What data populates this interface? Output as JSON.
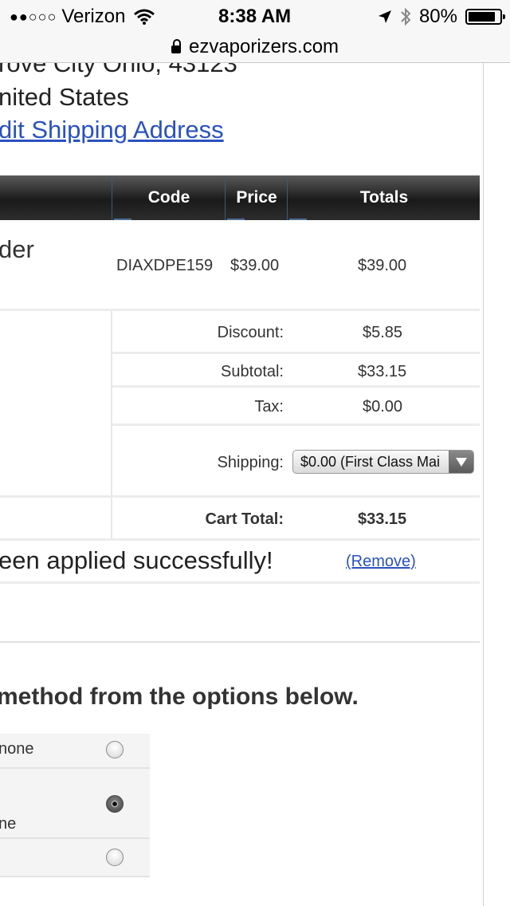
{
  "status_bar": {
    "carrier": "Verizon",
    "time": "8:38 AM",
    "battery": "80%",
    "icons": [
      "signal-dots-icon",
      "wifi-icon",
      "location-arrow-icon",
      "bluetooth-icon",
      "battery-icon"
    ]
  },
  "url_bar": {
    "domain": "ezvaporizers.com",
    "icon": "lock-icon"
  },
  "address": {
    "line1": "rove City Ohio, 43123",
    "line2": "nited States",
    "edit_link": "dit Shipping Address"
  },
  "table": {
    "headers": {
      "code": "Code",
      "price": "Price",
      "totals": "Totals"
    },
    "item": {
      "name": "der",
      "code": "DIAXDPE159",
      "price": "$39.00",
      "total": "$39.00"
    },
    "summary": {
      "discount_label": "Discount:",
      "discount_value": "$5.85",
      "subtotal_label": "Subtotal:",
      "subtotal_value": "$33.15",
      "tax_label": "Tax:",
      "tax_value": "$0.00",
      "shipping_label": "Shipping:",
      "shipping_selected": "$0.00 (First Class Mai",
      "cart_total_label": "Cart Total:",
      "cart_total_value": "$33.15"
    },
    "coupon_message": "een applied successfully!",
    "remove_link": "(Remove)"
  },
  "payment": {
    "heading": "method from the options below.",
    "options": [
      {
        "label": "none",
        "selected": false
      },
      {
        "label": "ne",
        "selected": true
      },
      {
        "label": "",
        "selected": false
      }
    ]
  },
  "colors": {
    "link": "#2a52be",
    "header_bg": "#1a1a1a"
  }
}
